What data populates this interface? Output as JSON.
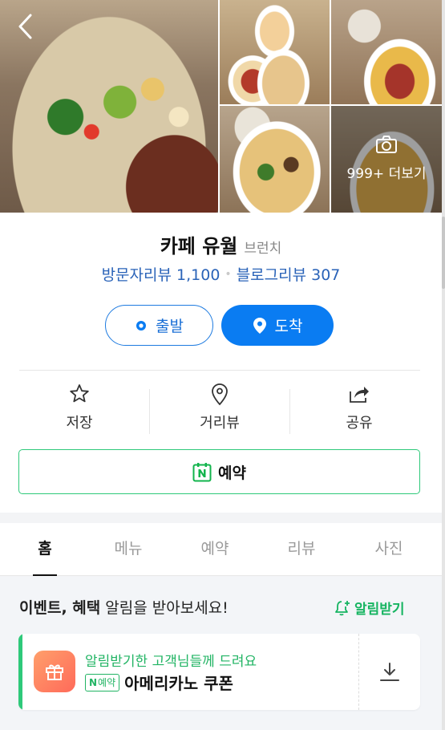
{
  "photos": {
    "more_label": "999+ 더보기",
    "items": [
      "main-salad-steak",
      "pasta-plates",
      "bacon-rice-dish",
      "rice-broccoli-dish",
      "fried-rice-dish"
    ]
  },
  "place": {
    "name": "카페 유월",
    "category": "브런치",
    "visitor_reviews_label": "방문자리뷰 1,100",
    "blog_reviews_label": "블로그리뷰 307"
  },
  "route": {
    "departure_label": "출발",
    "arrival_label": "도착"
  },
  "actions": {
    "save_label": "저장",
    "distance_label": "거리뷰",
    "share_label": "공유"
  },
  "reserve": {
    "label": "예약"
  },
  "tabs": [
    {
      "label": "홈",
      "active": true
    },
    {
      "label": "메뉴",
      "active": false
    },
    {
      "label": "예약",
      "active": false
    },
    {
      "label": "리뷰",
      "active": false
    },
    {
      "label": "사진",
      "active": false
    }
  ],
  "notice": {
    "title_bold": "이벤트, 혜택",
    "title_rest": " 알림을 받아보세요!",
    "notify_label": "알림받기"
  },
  "coupon": {
    "subtitle": "알림받기한 고객님들께 드려요",
    "badge_n": "N",
    "badge_text": "예약",
    "name": "아메리카노 쿠폰"
  },
  "colors": {
    "primary_blue": "#0a7cf2",
    "naver_green": "#2ec97a",
    "link_blue": "#2a63b8"
  }
}
